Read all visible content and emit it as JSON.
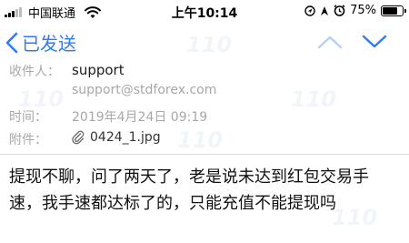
{
  "status_bar": {
    "carrier": "中国联通",
    "time": "上午10:14",
    "battery_percent": "75%",
    "battery_level": 0.75,
    "icons": [
      "signal-icon",
      "wifi-icon",
      "location-icon",
      "alarm-icon"
    ]
  },
  "nav": {
    "back_label": "已发送",
    "accent_color": "#2f7cf6"
  },
  "email": {
    "recipient_label": "收件人：",
    "recipient_name": "support",
    "recipient_email": "support@stdforex.com",
    "time_label": "时间：",
    "time_value": "2019年4月24日 09:19",
    "attachment_label": "附件：",
    "attachment_name": "0424_1.jpg",
    "body_line1": "提现不聊，问了两天了，老是说未达到红包交易手",
    "body_line2": "速，我手速都达标了的，只能充值不能提现吗"
  },
  "watermark": "110"
}
